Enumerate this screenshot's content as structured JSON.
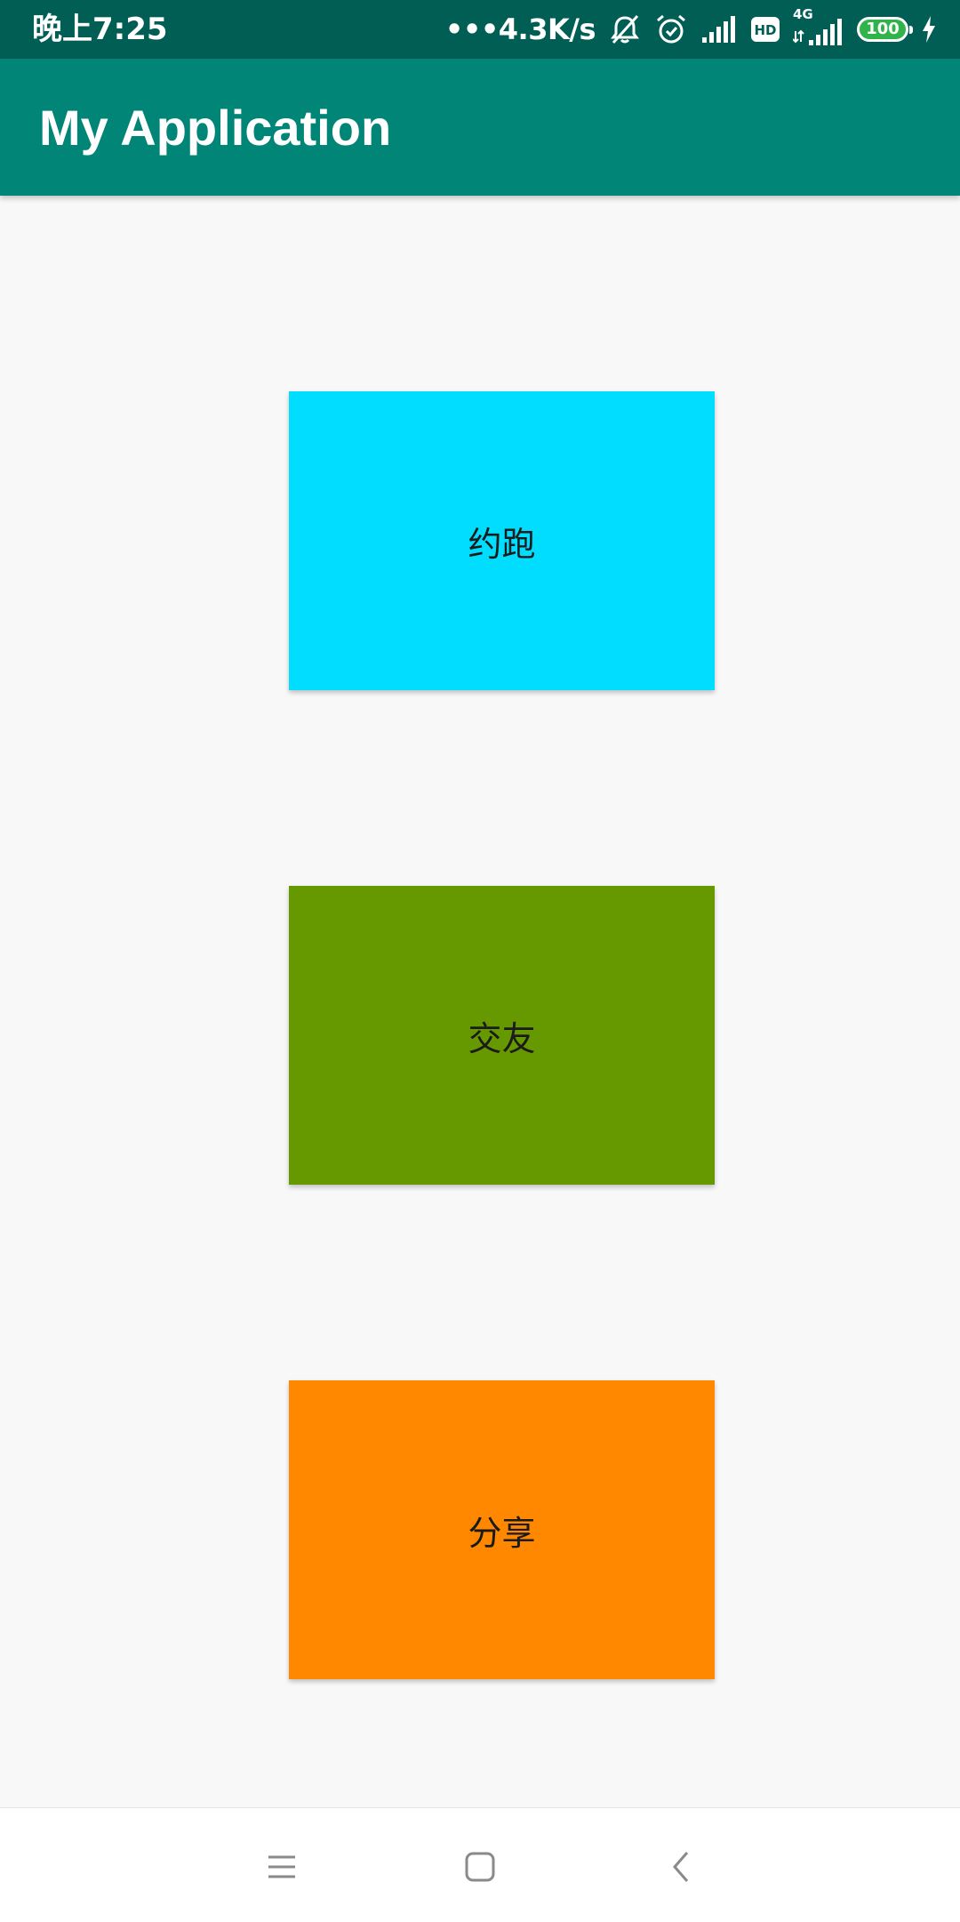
{
  "status_bar": {
    "time": "晚上7:25",
    "net_speed": "•••4.3K/s",
    "network_type": "4G",
    "battery_level": "100",
    "icons": [
      "mute-vibrate-icon",
      "alarm-icon",
      "signal-icon",
      "hd-icon",
      "signal-4g-icon",
      "battery-icon",
      "charging-icon"
    ]
  },
  "app_bar": {
    "title": "My Application",
    "color": "#008577"
  },
  "tiles": [
    {
      "label": "约跑",
      "color": "#00DDFF"
    },
    {
      "label": "交友",
      "color": "#669900"
    },
    {
      "label": "分享",
      "color": "#FF8800"
    }
  ],
  "nav_bar": {
    "icons": [
      "menu-icon",
      "home-icon",
      "back-icon"
    ]
  }
}
